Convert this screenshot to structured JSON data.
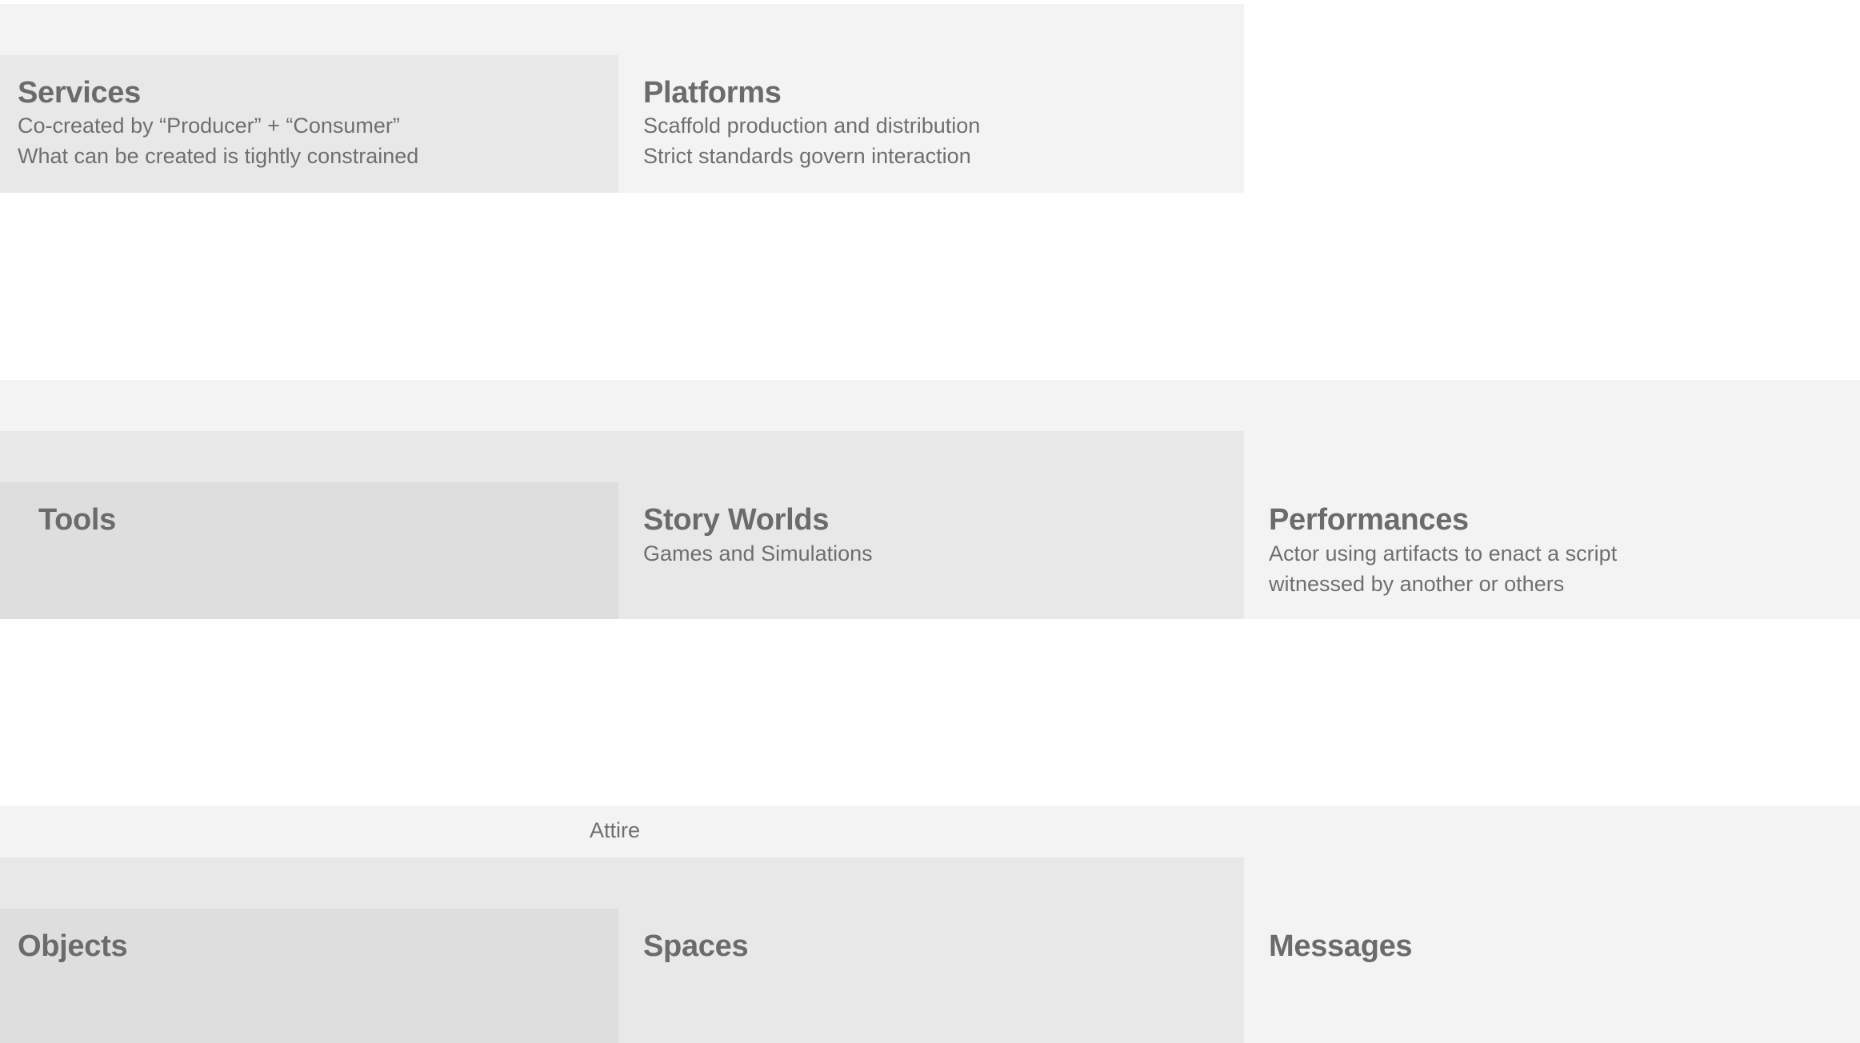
{
  "row1": {
    "services": {
      "title": "Services",
      "lines": [
        "Co-created by “Producer” + “Consumer”",
        "What can be created is tightly constrained"
      ]
    },
    "platforms": {
      "title": "Platforms",
      "lines": [
        "Scaffold production and distribution",
        "Strict standards govern interaction"
      ]
    }
  },
  "row2": {
    "tools": {
      "title": "Tools"
    },
    "story_worlds": {
      "title": "Story Worlds",
      "lines": [
        "Games and Simulations"
      ]
    },
    "performances": {
      "title": "Performances",
      "lines": [
        "Actor using artifacts to enact a script",
        "witnessed by another or others"
      ]
    }
  },
  "row3": {
    "attire": {
      "label": "Attire"
    },
    "objects": {
      "title": "Objects"
    },
    "spaces": {
      "title": "Spaces"
    },
    "messages": {
      "title": "Messages"
    }
  }
}
